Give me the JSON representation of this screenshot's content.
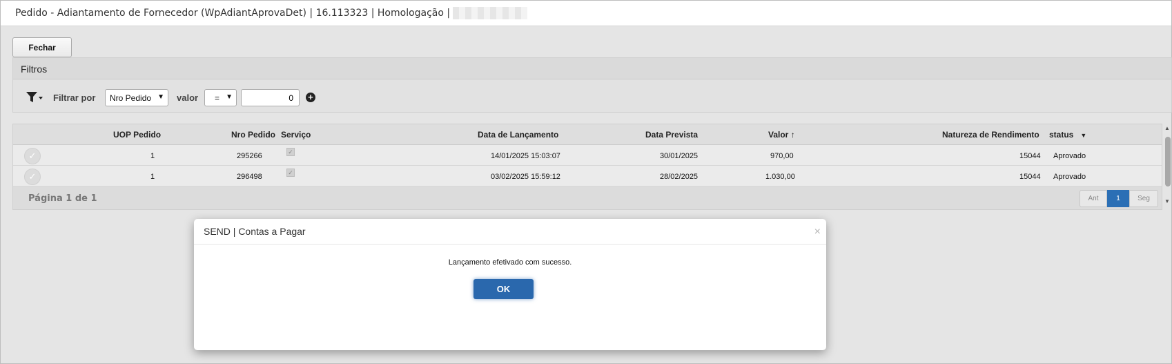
{
  "window": {
    "title": "Pedido - Adiantamento de Fornecedor (WpAdiantAprovaDet) | 16.113323 | Homologação |"
  },
  "toolbar": {
    "close_label": "Fechar"
  },
  "filters": {
    "header": "Filtros",
    "filter_by_label": "Filtrar por",
    "field_selected": "Nro Pedido",
    "value_label": "valor",
    "operator_selected": "=",
    "value_input": "0"
  },
  "grid": {
    "columns": [
      "UOP Pedido",
      "Nro Pedido",
      "Serviço",
      "Data de Lançamento",
      "Data Prevista",
      "Valor",
      "Natureza de Rendimento",
      "status"
    ],
    "rows": [
      {
        "uop": "1",
        "nro": "295266",
        "data_lanc": "14/01/2025 15:03:07",
        "data_prev": "30/01/2025",
        "valor": "970,00",
        "natureza": "15044",
        "status": "Aprovado"
      },
      {
        "uop": "1",
        "nro": "296498",
        "data_lanc": "03/02/2025 15:59:12",
        "data_prev": "28/02/2025",
        "valor": "1.030,00",
        "natureza": "15044",
        "status": "Aprovado"
      }
    ],
    "page_info": "Página 1 de 1",
    "pager": {
      "prev": "Ant",
      "current": "1",
      "next": "Seg"
    }
  },
  "modal": {
    "title": "SEND | Contas a Pagar",
    "message": "Lançamento efetivado com sucesso.",
    "ok_label": "OK",
    "close_glyph": "×"
  },
  "colors": {
    "accent": "#2b6fb5",
    "ok_button": "#2a68ad"
  }
}
